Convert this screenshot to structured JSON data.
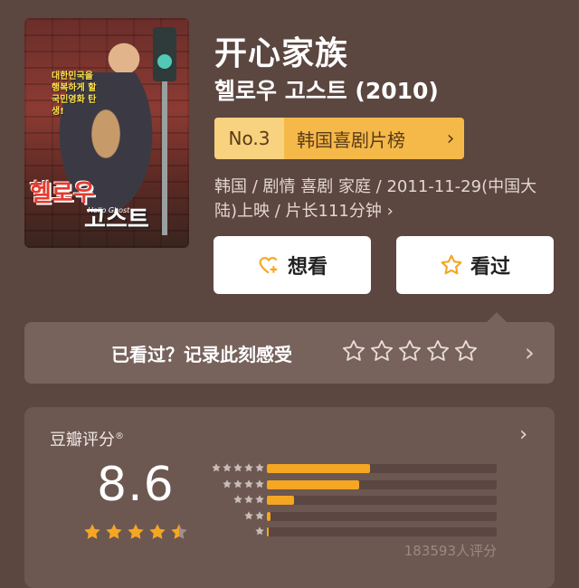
{
  "poster": {
    "logo_line1": "헬로우",
    "logo_line2": "고스트",
    "subtitle": "Hello Ghost",
    "tagline": "대한민국을 행복하게 할 국민영화 탄생!"
  },
  "movie": {
    "title_cn": "开心家族",
    "title_original": "헬로우 고스트 (2010)",
    "rank_no": "No.3",
    "rank_name": "韩国喜剧片榜",
    "meta": "韩国 / 剧情 喜剧 家庭 / 2011-11-29(中国大陆)上映 / 片长111分钟 ›"
  },
  "actions": {
    "want_label": "想看",
    "seen_label": "看过"
  },
  "seen_bar": {
    "prompt": "已看过？记录此刻感受"
  },
  "rating": {
    "source": "豆瓣评分",
    "source_mark": "®",
    "score": "8.6",
    "stars_value": 4.5,
    "distribution": [
      {
        "stars": 5,
        "fraction": 0.45
      },
      {
        "stars": 4,
        "fraction": 0.4
      },
      {
        "stars": 3,
        "fraction": 0.12
      },
      {
        "stars": 2,
        "fraction": 0.015
      },
      {
        "stars": 1,
        "fraction": 0.008
      }
    ],
    "count_text": "183593人评分"
  },
  "colors": {
    "background": "#5b4640",
    "accent": "#f5a623",
    "rank_bg": "#f5b94a"
  }
}
